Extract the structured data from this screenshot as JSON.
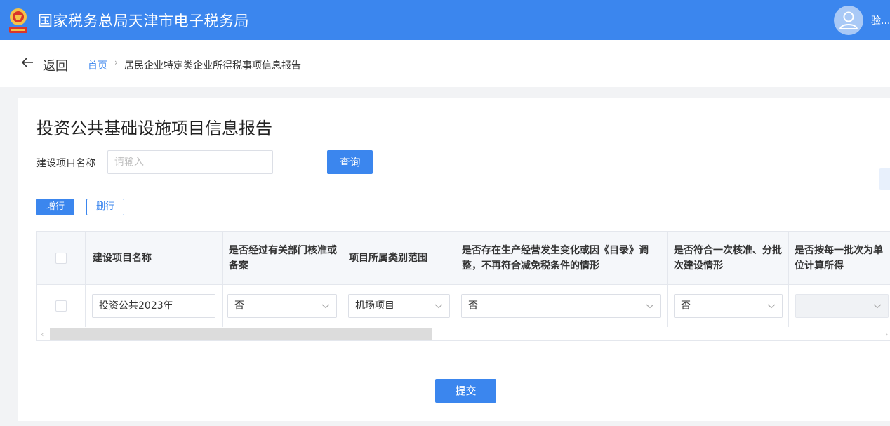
{
  "header": {
    "app_title": "国家税务总局天津市电子税务局",
    "user_name": "验...",
    "brand_color": "#3b86ee"
  },
  "nav": {
    "back_label": "返回",
    "breadcrumb_home": "首页",
    "breadcrumb_separator": "›",
    "breadcrumb_current": "居民企业特定类企业所得税事项信息报告"
  },
  "main": {
    "page_title": "投资公共基础设施项目信息报告",
    "search": {
      "label": "建设项目名称",
      "placeholder": "请输入",
      "value": ""
    },
    "query_button": "查询",
    "add_row_button": "增行",
    "delete_row_button": "删行",
    "submit_button": "提交"
  },
  "table": {
    "columns": [
      "",
      "建设项目名称",
      "是否经过有关部门核准或备案",
      "项目所属类别范围",
      "是否存在生产经营发生变化或因《目录》调整，不再符合减免税条件的情形",
      "是否符合一次核准、分批次建设情形",
      "是否按每一批次为单位计算所得"
    ],
    "rows": [
      {
        "checked": false,
        "project_name": "投资公共2023年",
        "approved_or_filed": "否",
        "category": "机场项目",
        "no_longer_qualifies": "否",
        "batch_construction": "否",
        "per_batch_income": ""
      }
    ]
  },
  "icons": {
    "logo": "tax-emblem-icon",
    "avatar": "user-avatar-icon",
    "back": "arrow-left-icon",
    "dropdown": "chevron-down-icon"
  }
}
